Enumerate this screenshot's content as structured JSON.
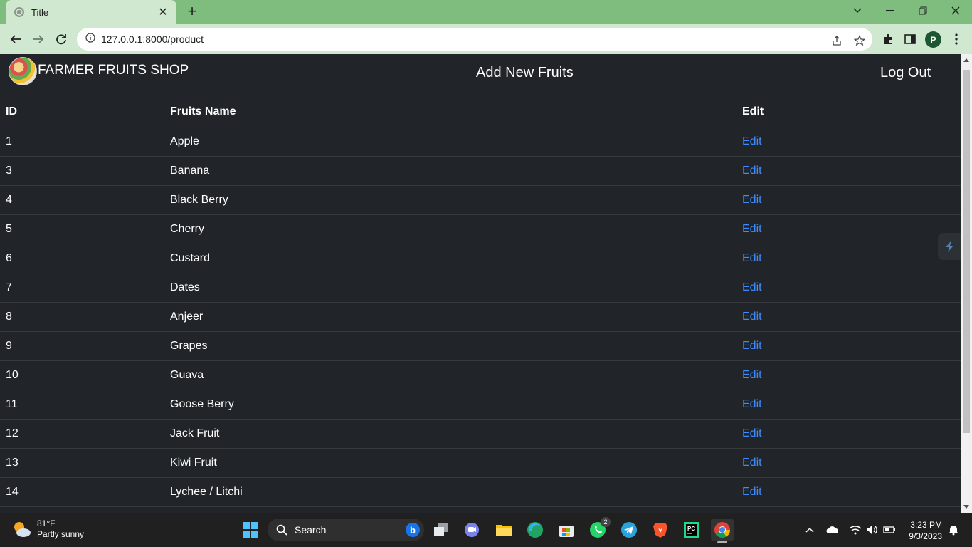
{
  "browser": {
    "tab_title": "Title",
    "url": "127.0.0.1:8000/product",
    "profile_initial": "P"
  },
  "navbar": {
    "brand": "FARMER FRUITS SHOP",
    "add_link": "Add New Fruits",
    "logout_link": "Log Out"
  },
  "table": {
    "headers": {
      "id": "ID",
      "name": "Fruits Name",
      "edit": "Edit"
    },
    "rows": [
      {
        "id": "1",
        "name": "Apple",
        "edit": "Edit"
      },
      {
        "id": "3",
        "name": "Banana",
        "edit": "Edit"
      },
      {
        "id": "4",
        "name": "Black Berry",
        "edit": "Edit"
      },
      {
        "id": "5",
        "name": "Cherry",
        "edit": "Edit"
      },
      {
        "id": "6",
        "name": "Custard",
        "edit": "Edit"
      },
      {
        "id": "7",
        "name": "Dates",
        "edit": "Edit"
      },
      {
        "id": "8",
        "name": "Anjeer",
        "edit": "Edit"
      },
      {
        "id": "9",
        "name": "Grapes",
        "edit": "Edit"
      },
      {
        "id": "10",
        "name": "Guava",
        "edit": "Edit"
      },
      {
        "id": "11",
        "name": "Goose Berry",
        "edit": "Edit"
      },
      {
        "id": "12",
        "name": "Jack Fruit",
        "edit": "Edit"
      },
      {
        "id": "13",
        "name": "Kiwi Fruit",
        "edit": "Edit"
      },
      {
        "id": "14",
        "name": "Lychee / Litchi",
        "edit": "Edit"
      }
    ]
  },
  "taskbar": {
    "weather_temp": "81°F",
    "weather_desc": "Partly sunny",
    "search_label": "Search",
    "whatsapp_badge": "2",
    "pycharm_label": "PC",
    "time": "3:23 PM",
    "date": "9/3/2023"
  },
  "colors": {
    "page_bg": "#212529",
    "link": "#3d8bfd",
    "chrome_tab": "#cfe8cf",
    "chrome_frame": "#7fbd7f"
  }
}
